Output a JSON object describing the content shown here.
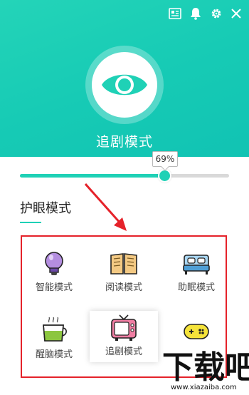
{
  "header": {
    "mode_title": "追剧模式",
    "colors": {
      "gradient_start": "#24d4b8",
      "gradient_end": "#11c3b3"
    },
    "toolbar": [
      {
        "name": "news-icon"
      },
      {
        "name": "bell-icon"
      },
      {
        "name": "gear-icon"
      },
      {
        "name": "close-icon"
      }
    ]
  },
  "slider": {
    "value_percent": 69,
    "tooltip": "69%",
    "accent": "#1fd1b6"
  },
  "section": {
    "title": "护眼模式"
  },
  "annotation": {
    "color": "#e5222a"
  },
  "modes": [
    {
      "label": "智能模式",
      "icon": "bulb-icon"
    },
    {
      "label": "阅读模式",
      "icon": "book-icon"
    },
    {
      "label": "助眠模式",
      "icon": "bed-icon"
    },
    {
      "label": "醒脑模式",
      "icon": "tea-cup-icon"
    },
    {
      "label": "追剧模式",
      "icon": "tv-icon",
      "selected": true
    },
    {
      "label": "",
      "icon": "gamepad-icon"
    }
  ],
  "watermark": {
    "text": "下载吧",
    "url": "www.xiazaiba.com"
  }
}
